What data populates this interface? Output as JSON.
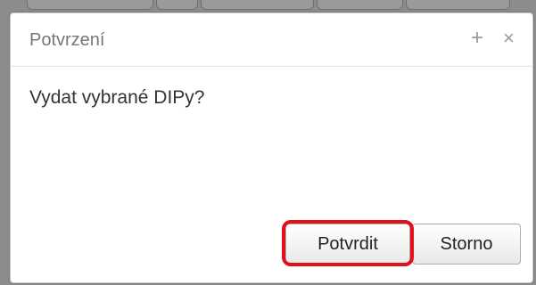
{
  "dialog": {
    "title": "Potvrzení",
    "message": "Vydat vybrané DIPy?",
    "icons": {
      "maximize": "plus-icon",
      "close": "close-icon"
    },
    "buttons": {
      "confirm_label": "Potvrdit",
      "cancel_label": "Storno"
    },
    "highlight_color": "#e0111b"
  }
}
